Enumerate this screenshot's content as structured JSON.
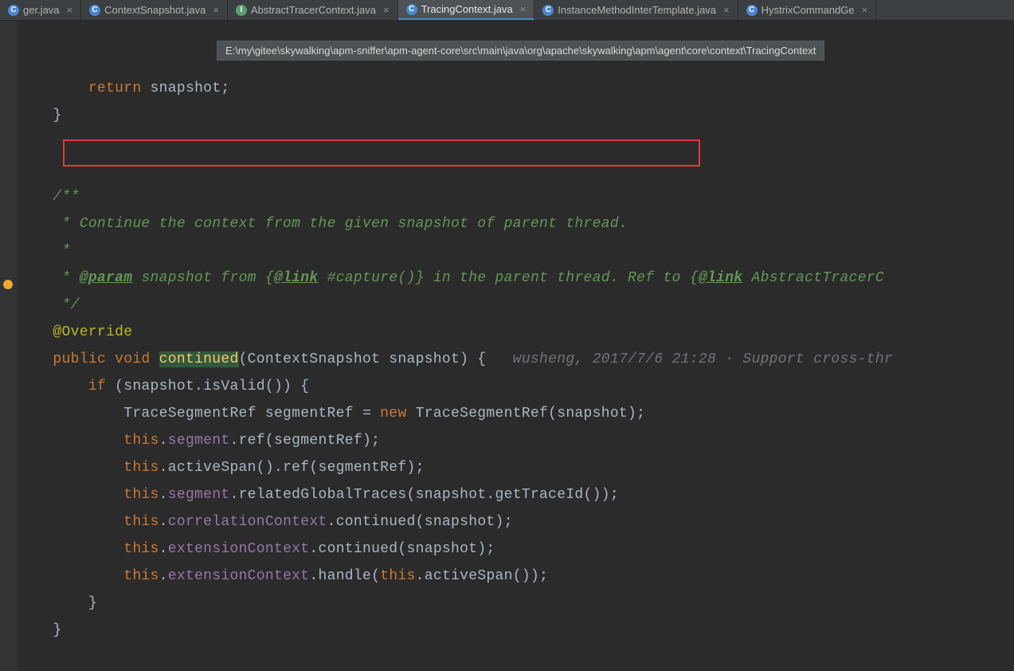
{
  "tabs": [
    {
      "label": "ger.java",
      "iconClass": "icon-class",
      "iconLetter": "C"
    },
    {
      "label": "ContextSnapshot.java",
      "iconClass": "icon-class",
      "iconLetter": "C"
    },
    {
      "label": "AbstractTracerContext.java",
      "iconClass": "icon-interface",
      "iconLetter": "I"
    },
    {
      "label": "TracingContext.java",
      "iconClass": "icon-class",
      "iconLetter": "C"
    },
    {
      "label": "InstanceMethodInterTemplate.java",
      "iconClass": "icon-class",
      "iconLetter": "C"
    },
    {
      "label": "HystrixCommandGe",
      "iconClass": "icon-class",
      "iconLetter": "C"
    }
  ],
  "activeTabIndex": 3,
  "tooltip": "E:\\my\\gitee\\skywalking\\apm-sniffer\\apm-agent-core\\src\\main\\java\\org\\apache\\skywalking\\apm\\agent\\core\\context\\TracingContext",
  "code": {
    "pre_return": "return",
    "pre_snap": " snapshot;",
    "brace1": "    }",
    "doc_open": "    /**",
    "doc_line1_pre": "     * ",
    "doc_line1_hl": "Continue the context from the given snapshot of parent thread",
    "doc_line1_post": ".",
    "doc_blank": "     *",
    "doc_param_star": "     * ",
    "doc_param_tag": "@param",
    "doc_param_mid": " snapshot from {",
    "doc_link1": "@link",
    "doc_param_mid2": " #capture()} in the parent thread. Ref to {",
    "doc_link2": "@link",
    "doc_param_end": " AbstractTracerC",
    "doc_close": "     */",
    "ann": "    @Override",
    "sig_public": "    public ",
    "sig_void": "void ",
    "sig_method": "continued",
    "sig_params": "(ContextSnapshot snapshot) {",
    "inlay": "   wusheng, 2017/7/6 21:28 · Support cross-thr",
    "if_kw": "        if ",
    "if_cond": "(snapshot.isValid()) {",
    "l1a": "            TraceSegmentRef segmentRef = ",
    "l1_new": "new ",
    "l1b": "TraceSegmentRef(snapshot);",
    "l_this": "            this",
    "l2_dot": ".",
    "l2_field": "segment",
    "l2_rest": ".ref(segmentRef);",
    "l3_rest": ".activeSpan().ref(segmentRef);",
    "l4_field": "segment",
    "l4_rest": ".relatedGlobalTraces(snapshot.getTraceId());",
    "l5_field": "correlationContext",
    "l5_rest": ".continued(snapshot);",
    "l6_field": "extensionContext",
    "l6_rest": ".continued(snapshot);",
    "l7_field": "extensionContext",
    "l7_mid": ".handle(",
    "l7_this": "this",
    "l7_rest": ".activeSpan());",
    "close1": "        }",
    "close2": "    }"
  }
}
